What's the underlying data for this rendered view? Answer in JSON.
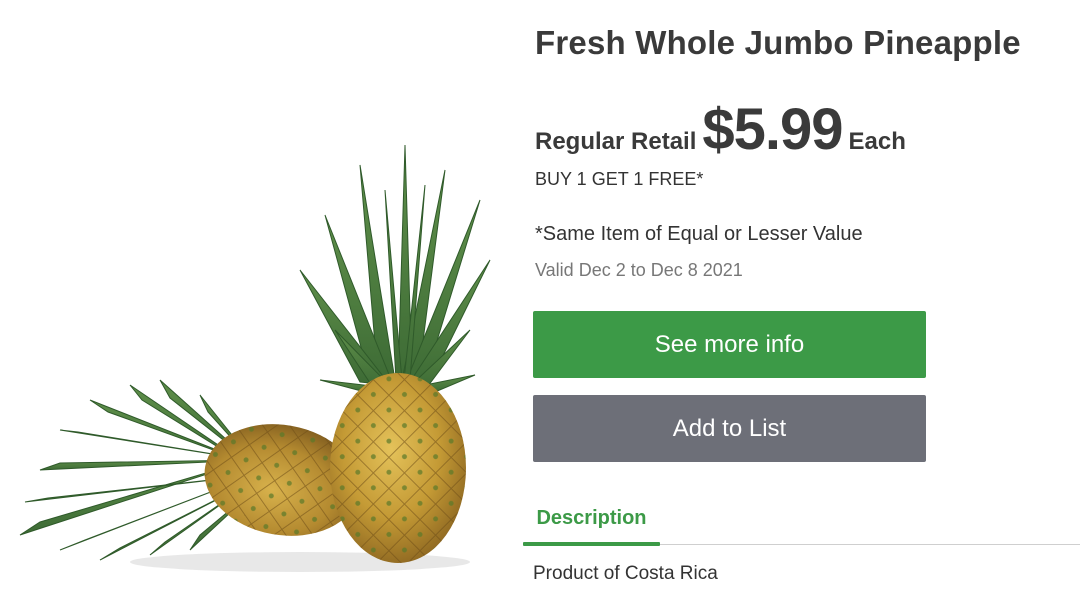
{
  "product": {
    "title": "Fresh Whole Jumbo Pineapple",
    "image_icon": "pineapple-illustration"
  },
  "price": {
    "prefix": "Regular Retail",
    "amount": "$5.99",
    "unit": "Each"
  },
  "promotion": {
    "offer": "BUY 1 GET 1 FREE*",
    "condition": "*Same Item of Equal or Lesser Value",
    "validity": "Valid Dec 2 to Dec 8 2021"
  },
  "actions": {
    "more_info_label": "See more info",
    "add_to_list_label": "Add to List"
  },
  "tabs": [
    {
      "label": "Description",
      "active": true
    }
  ],
  "description": {
    "text": "Product of Costa Rica"
  },
  "colors": {
    "accent_green": "#3c9a47",
    "button_gray": "#6d6f78",
    "text_dark": "#3a3a3a",
    "text_muted": "#777777"
  }
}
